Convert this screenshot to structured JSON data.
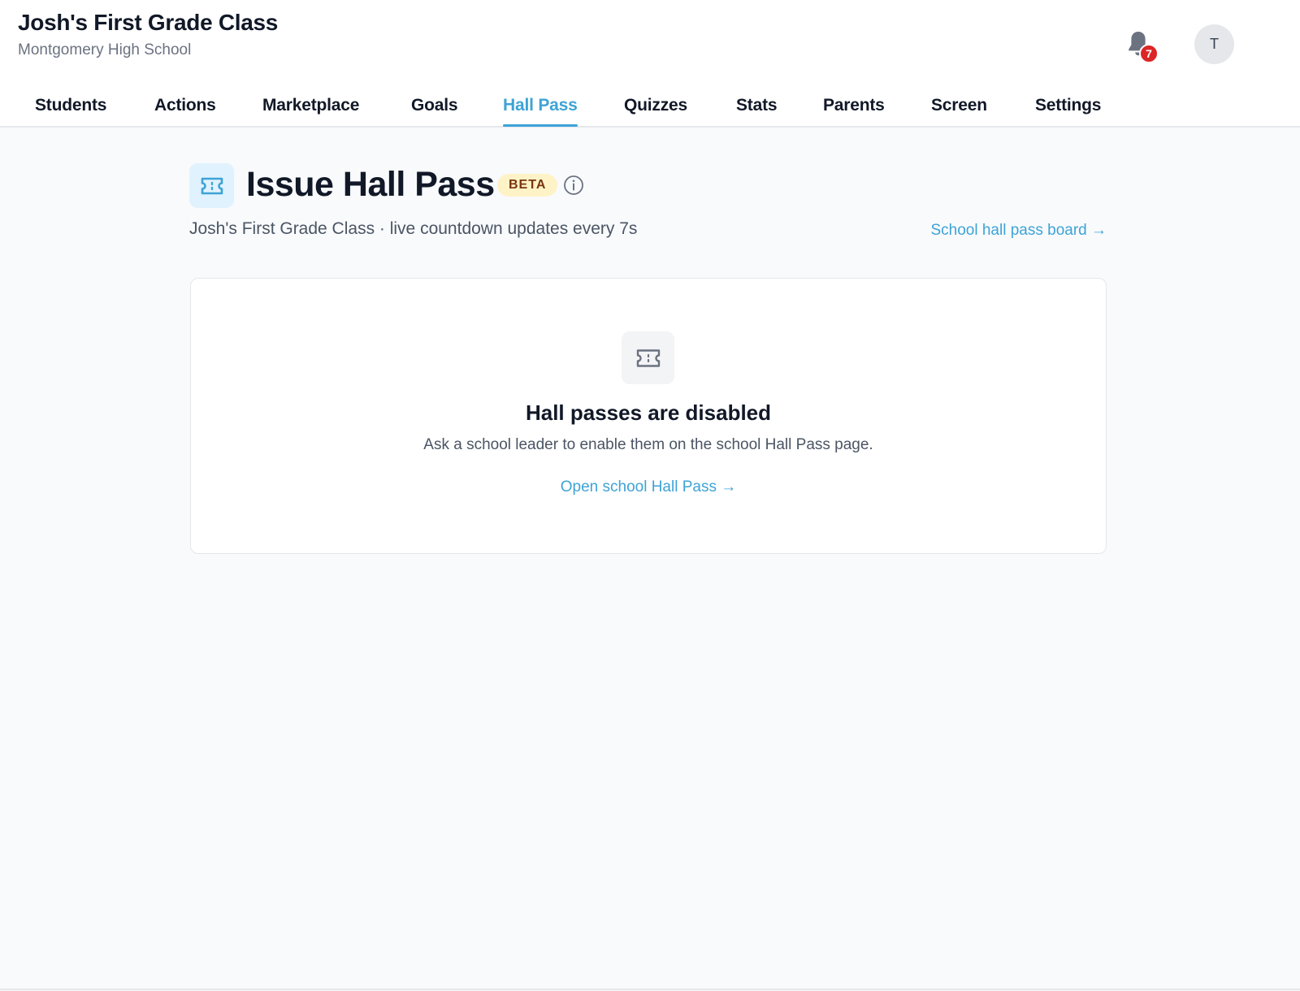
{
  "header": {
    "class_title": "Josh's First Grade Class",
    "school_name": "Montgomery High School",
    "notifications": {
      "icon": "bell-icon",
      "count": "7",
      "badge_color": "#dc2626"
    },
    "avatar_initial": "T"
  },
  "tabs": [
    {
      "label": "Students",
      "active": false
    },
    {
      "label": "Actions",
      "active": false
    },
    {
      "label": "Marketplace",
      "active": false
    },
    {
      "label": "Goals",
      "active": false
    },
    {
      "label": "Hall Pass",
      "active": true
    },
    {
      "label": "Quizzes",
      "active": false
    },
    {
      "label": "Stats",
      "active": false
    },
    {
      "label": "Parents",
      "active": false
    },
    {
      "label": "Screen",
      "active": false
    },
    {
      "label": "Settings",
      "active": false
    }
  ],
  "page": {
    "icon": "ticket-icon",
    "title": "Issue Hall Pass",
    "badge": "BETA",
    "info_icon": "info-icon",
    "subtitle": "Josh's First Grade Class · live countdown updates every 7s",
    "board_link": "School hall pass board →"
  },
  "empty_state": {
    "icon": "ticket-icon",
    "heading": "Hall passes are disabled",
    "message": "Ask a school leader to enable them on the school Hall Pass page.",
    "link": "Open school Hall Pass →"
  },
  "colors": {
    "accent": "#3ea3d6",
    "background": "#f8fafc",
    "badge_bg": "#fef3c7",
    "badge_text": "#78350f"
  }
}
